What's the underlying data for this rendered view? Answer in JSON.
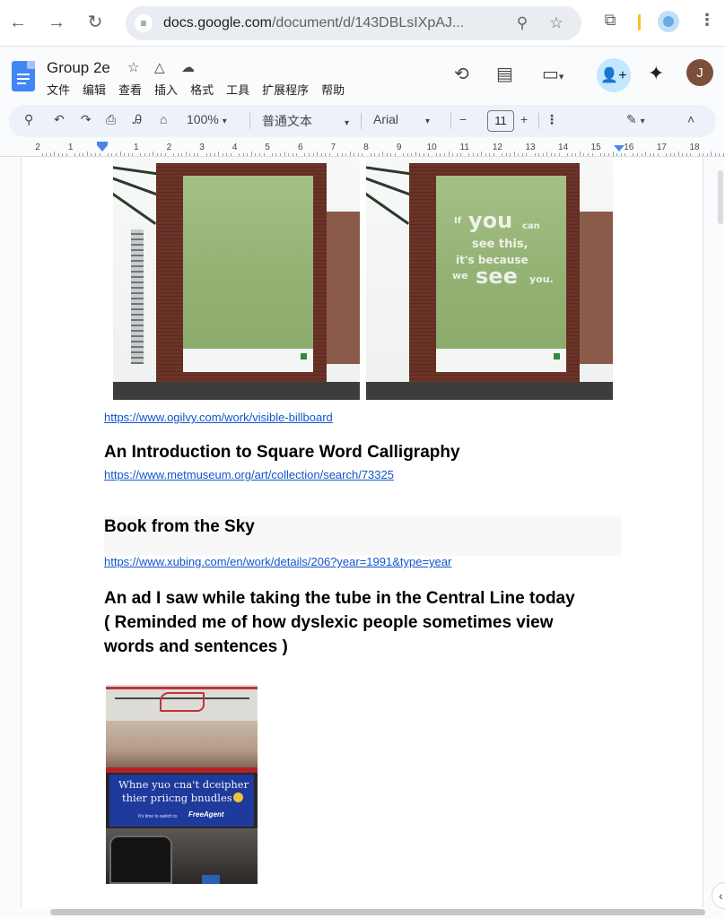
{
  "browser": {
    "url_host": "docs.google.com",
    "url_path": "/document/d/143DBLsIXpAJ...",
    "profile_initial": "J"
  },
  "docs": {
    "title": "Group 2e",
    "menu": [
      "文件",
      "编辑",
      "查看",
      "插入",
      "格式",
      "工具",
      "扩展程序",
      "帮助"
    ],
    "avatar_initial": "J"
  },
  "toolbar": {
    "zoom": "100%",
    "style": "普通文本",
    "font": "Arial",
    "font_size": "11",
    "minus": "−",
    "plus": "+"
  },
  "ruler": {
    "labels": [
      "2",
      "1",
      "",
      "1",
      "2",
      "3",
      "4",
      "5",
      "6",
      "7",
      "8",
      "9",
      "10",
      "11",
      "12",
      "13",
      "14",
      "15",
      "16",
      "17",
      "18"
    ]
  },
  "content": {
    "billboard_message": [
      "If",
      "you",
      "can",
      "see this,",
      "it's because",
      "we",
      "see",
      "you."
    ],
    "link1": "https://www.ogilvy.com/work/visible-billboard",
    "heading1": "An Introduction to Square Word Calligraphy",
    "link2": "https://www.metmuseum.org/art/collection/search/73325",
    "heading2": "Book from the Sky",
    "link3": "https://www.xubing.com/en/work/details/206?year=1991&type=year",
    "heading3_lines": [
      "An ad I saw while taking the tube in the Central Line today",
      "( Reminded me of how dyslexic people sometimes view",
      "words and sentences )"
    ],
    "tube_ad": {
      "line1": "Whne yuo cna't dceipher",
      "line2": "thier priicng bnudles",
      "small": "It's time to switch to",
      "brand": "FreeAgent"
    }
  }
}
